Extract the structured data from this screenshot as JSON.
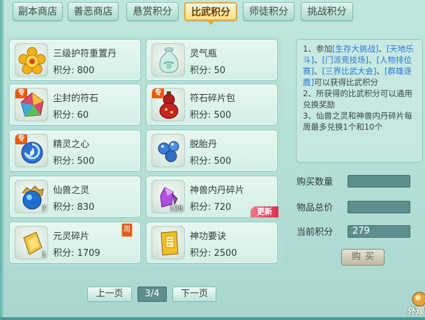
{
  "tabs": [
    {
      "label": "副本商店",
      "active": false
    },
    {
      "label": "善恶商店",
      "active": false
    },
    {
      "label": "悬赏积分",
      "active": false
    },
    {
      "label": "比武积分",
      "active": true
    },
    {
      "label": "师徒积分",
      "active": false
    },
    {
      "label": "挑战积分",
      "active": false
    }
  ],
  "items": [
    {
      "name": "三级护符重置丹",
      "price": "积分: 800",
      "icon": "gold-flower-talisman-icon"
    },
    {
      "name": "灵气瓶",
      "price": "积分: 50",
      "icon": "jade-vase-icon"
    },
    {
      "name": "尘封的符石",
      "price": "积分: 60",
      "icon": "colorful-rune-stone-icon",
      "tag": "专"
    },
    {
      "name": "符石碎片包",
      "price": "积分: 500",
      "icon": "red-gourd-bag-icon",
      "tag": "专"
    },
    {
      "name": "精灵之心",
      "price": "积分: 500",
      "icon": "blue-swirl-heart-icon",
      "tag": "专"
    },
    {
      "name": "脱胎丹",
      "price": "积分: 500",
      "icon": "blue-pills-icon"
    },
    {
      "name": "仙兽之灵",
      "price": "积分: 830",
      "icon": "blue-orb-icon",
      "count": "7"
    },
    {
      "name": "神兽内丹碎片",
      "price": "积分: 720",
      "icon": "purple-crystal-icon",
      "count": "128",
      "badge": "更新"
    },
    {
      "name": "元灵碎片",
      "price": "积分: 1709",
      "icon": "gold-shard-icon",
      "count": "1",
      "badge": "周"
    },
    {
      "name": "神功要诀",
      "price": "积分: 2500",
      "icon": "gold-book-icon"
    }
  ],
  "rules": {
    "p1_a": "1、参加",
    "p1_b": "[生存大挑战]",
    "p1_c": "、",
    "p1_d": "[天地乐斗]",
    "p1_e": "、",
    "p1_f": "[门派竞技场]",
    "p1_g": "、",
    "p1_h": "[人物排位赛]",
    "p1_i": "、",
    "p1_j": "[三界比武大会]",
    "p1_k": "、",
    "p1_l": "[群雄逐鹿]",
    "p1_m": "可以获得比武积分",
    "p2": "2、所获得的比武积分可以通用兑换奖励",
    "p3": "3、仙兽之灵和神兽内丹碎片每周最多兑换1个和10个"
  },
  "side": {
    "qty_label": "购买数量",
    "total_label": "物品总价",
    "current_label": "当前积分",
    "qty_value": "",
    "total_value": "",
    "current_value": "279",
    "buy_label": "购买"
  },
  "pager": {
    "prev": "上一页",
    "page": "3/4",
    "next": "下一页"
  },
  "corner_text": "外观",
  "colors": {
    "highlight": "#2c76d6",
    "active_tab": "#f7df86",
    "new_badge": "#d8334e",
    "field": "#5d8f8d"
  }
}
